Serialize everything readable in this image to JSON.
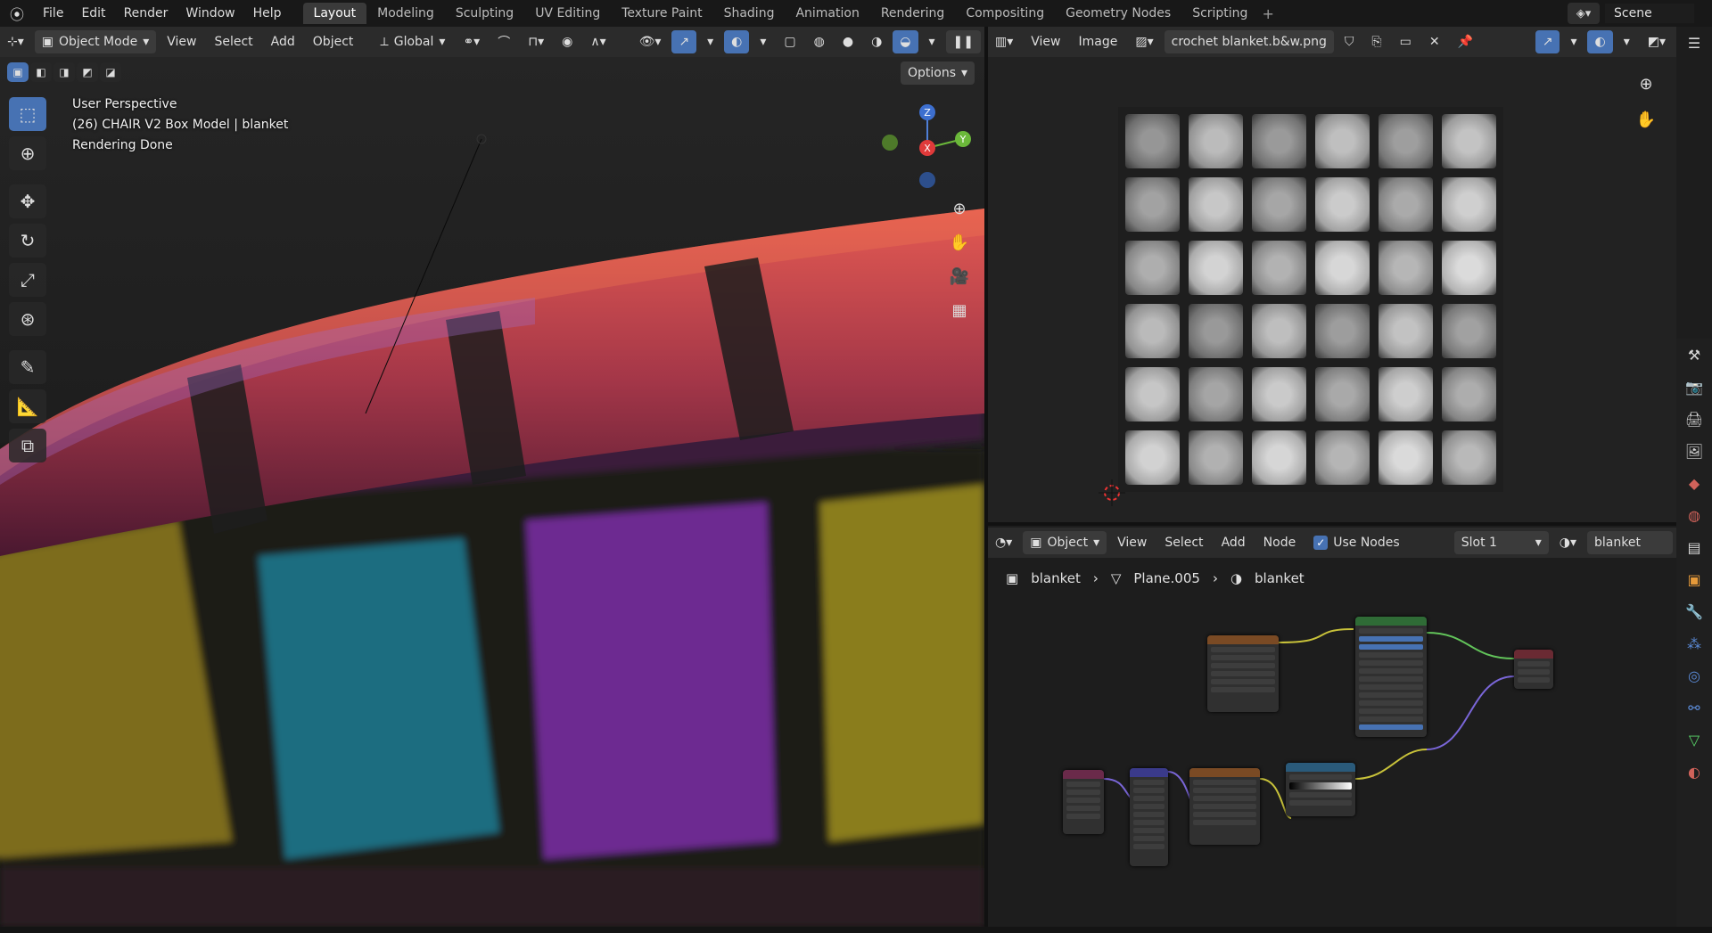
{
  "top_bar": {
    "menu": [
      "File",
      "Edit",
      "Render",
      "Window",
      "Help"
    ],
    "workspaces": [
      "Layout",
      "Modeling",
      "Sculpting",
      "UV Editing",
      "Texture Paint",
      "Shading",
      "Animation",
      "Rendering",
      "Compositing",
      "Geometry Nodes",
      "Scripting"
    ],
    "active_workspace": "Layout",
    "add_workspace": "+",
    "scene_name": "Scene"
  },
  "viewport_header": {
    "mode": "Object Mode",
    "menus": [
      "View",
      "Select",
      "Add",
      "Object"
    ],
    "orientation": "Global",
    "options_label": "Options"
  },
  "viewport_overlay": {
    "perspective": "User Perspective",
    "collection_info": "(26) CHAIR V2 Box Model | blanket",
    "status": "Rendering Done"
  },
  "gizmo": {
    "z": "Z",
    "x": "X",
    "y": "Y"
  },
  "image_editor": {
    "menus": [
      "View",
      "Image"
    ],
    "image_name": "crochet blanket.b&w.png"
  },
  "node_editor": {
    "object_type": "Object",
    "menus": [
      "View",
      "Select",
      "Add",
      "Node"
    ],
    "use_nodes_label": "Use Nodes",
    "use_nodes_checked": true,
    "slot": "Slot 1",
    "material": "blanket",
    "breadcrumb": [
      "blanket",
      "Plane.005",
      "blanket"
    ]
  },
  "colors": {
    "accent": "#4772b3",
    "node_link_yellow": "#c8c23a",
    "node_link_green": "#62c45a",
    "node_link_purple": "#7a66d8"
  }
}
